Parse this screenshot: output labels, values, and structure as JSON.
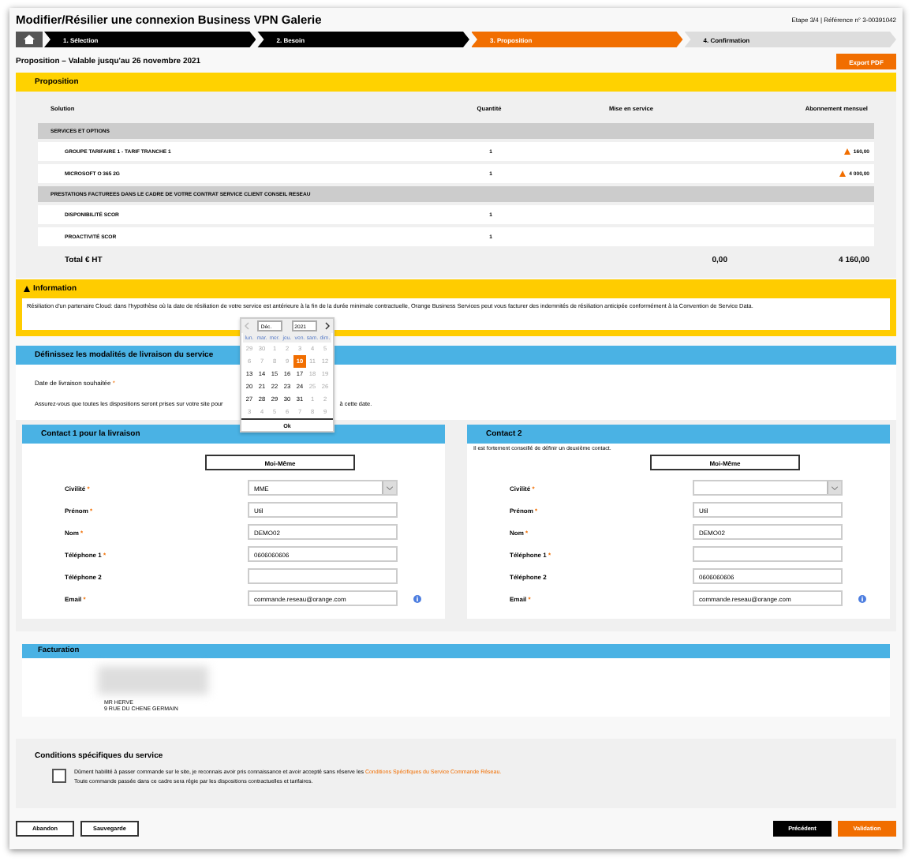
{
  "header": {
    "title": "Modifier/Résilier une connexion Business VPN Galerie",
    "step_info": "Etape 3/4 | Référence n° 3-00391042"
  },
  "stepper": [
    {
      "label": "1. Sélection",
      "completed": true,
      "selected": false
    },
    {
      "label": "2. Besoin",
      "completed": true,
      "selected": false
    },
    {
      "label": "3. Proposition",
      "completed": false,
      "selected": true
    },
    {
      "label": "4. Confirmation",
      "completed": false,
      "selected": false
    }
  ],
  "proposal": {
    "validity": "Proposition – Valable jusqu'au 26 novembre 2021",
    "export_button": "Export PDF",
    "section_title": "Proposition",
    "columns": [
      "Solution",
      "Quantité",
      "Mise en service",
      "Abonnement mensuel"
    ],
    "groups": [
      {
        "title": "SERVICES ET OPTIONS",
        "rows": [
          {
            "solution": "GROUPE TARIFAIRE 1 - TARIF TRANCHE 1",
            "quantity": "1",
            "monthly": "160,00",
            "warning": true
          },
          {
            "solution": "MICROSOFT O 365 2G",
            "quantity": "1",
            "monthly": "4 000,00",
            "warning": true
          }
        ]
      },
      {
        "title": "PRESTATIONS FACTUREES DANS LE CADRE DE VOTRE CONTRAT SERVICE CLIENT CONSEIL RESEAU",
        "rows": [
          {
            "solution": "DISPONIBILITÉ SCOR",
            "quantity": "1",
            "warning": false
          },
          {
            "solution": "PROACTIVITÉ SCOR",
            "quantity": "1",
            "warning": false
          }
        ]
      }
    ],
    "total": {
      "label": "Total € HT",
      "setup": "0,00",
      "monthly": "4 160,00"
    }
  },
  "info": {
    "title": "Information",
    "text": "Résiliation d'un partenaire Cloud: dans l'hypothèse où la date de résiliation de votre service est antérieure à la fin de la durée minimale contractuelle, Orange Business Services peut vous facturer des indemnités de résiliation anticipée conformément à la Convention de Service Data."
  },
  "delivery": {
    "title": "Définissez les modalités de livraison du service",
    "date_label": "Date de livraison souhaitée",
    "required_mark": "*",
    "note_start": "Assurez-vous que toutes les dispositions seront prises sur votre site pour",
    "note_end": "à cette date."
  },
  "datepicker": {
    "month": "Déc.",
    "year": "2021",
    "weekdays": [
      "lun.",
      "mar.",
      "mer.",
      "jeu.",
      "ven.",
      "sam.",
      "dim."
    ],
    "days": [
      {
        "label": "29",
        "disabled": true,
        "selected": false
      },
      {
        "label": "30",
        "disabled": true,
        "selected": false
      },
      {
        "label": "1",
        "disabled": true,
        "selected": false
      },
      {
        "label": "2",
        "disabled": true,
        "selected": false
      },
      {
        "label": "3",
        "disabled": true,
        "selected": false
      },
      {
        "label": "4",
        "disabled": true,
        "selected": false
      },
      {
        "label": "5",
        "disabled": true,
        "selected": false
      },
      {
        "label": "6",
        "disabled": true,
        "selected": false
      },
      {
        "label": "7",
        "disabled": true,
        "selected": false
      },
      {
        "label": "8",
        "disabled": true,
        "selected": false
      },
      {
        "label": "9",
        "disabled": true,
        "selected": false
      },
      {
        "label": "10",
        "disabled": false,
        "selected": true
      },
      {
        "label": "11",
        "disabled": true,
        "selected": false
      },
      {
        "label": "12",
        "disabled": true,
        "selected": false
      },
      {
        "label": "13",
        "disabled": false,
        "selected": false
      },
      {
        "label": "14",
        "disabled": false,
        "selected": false
      },
      {
        "label": "15",
        "disabled": false,
        "selected": false
      },
      {
        "label": "16",
        "disabled": false,
        "selected": false
      },
      {
        "label": "17",
        "disabled": false,
        "selected": false
      },
      {
        "label": "18",
        "disabled": true,
        "selected": false
      },
      {
        "label": "19",
        "disabled": true,
        "selected": false
      },
      {
        "label": "20",
        "disabled": false,
        "selected": false
      },
      {
        "label": "21",
        "disabled": false,
        "selected": false
      },
      {
        "label": "22",
        "disabled": false,
        "selected": false
      },
      {
        "label": "23",
        "disabled": false,
        "selected": false
      },
      {
        "label": "24",
        "disabled": false,
        "selected": false
      },
      {
        "label": "25",
        "disabled": true,
        "selected": false
      },
      {
        "label": "26",
        "disabled": true,
        "selected": false
      },
      {
        "label": "27",
        "disabled": false,
        "selected": false
      },
      {
        "label": "28",
        "disabled": false,
        "selected": false
      },
      {
        "label": "29",
        "disabled": false,
        "selected": false
      },
      {
        "label": "30",
        "disabled": false,
        "selected": false
      },
      {
        "label": "31",
        "disabled": false,
        "selected": false
      },
      {
        "label": "1",
        "disabled": true,
        "selected": false
      },
      {
        "label": "2",
        "disabled": true,
        "selected": false
      },
      {
        "label": "3",
        "disabled": true,
        "selected": false
      },
      {
        "label": "4",
        "disabled": true,
        "selected": false
      },
      {
        "label": "5",
        "disabled": true,
        "selected": false
      },
      {
        "label": "6",
        "disabled": true,
        "selected": false
      },
      {
        "label": "7",
        "disabled": true,
        "selected": false
      },
      {
        "label": "8",
        "disabled": true,
        "selected": false
      },
      {
        "label": "9",
        "disabled": true,
        "selected": false
      }
    ],
    "ok": "Ok"
  },
  "contacts": [
    {
      "title": "Contact 1 pour la livraison",
      "me_button": "Moi-Même",
      "fields": [
        {
          "label": "Civilité",
          "required_mark": "*",
          "kind": "select",
          "value": "MME",
          "info": false
        },
        {
          "label": "Prénom",
          "required_mark": "*",
          "kind": "text",
          "value": "Util",
          "info": false
        },
        {
          "label": "Nom",
          "required_mark": "*",
          "kind": "text",
          "value": "DEMO02",
          "info": false
        },
        {
          "label": "Téléphone 1",
          "required_mark": "*",
          "kind": "text",
          "value": "0606060606",
          "info": false
        },
        {
          "label": "Téléphone 2",
          "kind": "text",
          "info": false
        },
        {
          "label": "Email",
          "required_mark": "*",
          "kind": "text",
          "value": "commande.reseau@orange.com",
          "info": true
        }
      ]
    },
    {
      "title": "Contact 2",
      "hint": "Il est fortement conseillé de définir un deuxième contact.",
      "me_button": "Moi-Même",
      "fields": [
        {
          "label": "Civilité",
          "required_mark": "*",
          "kind": "select",
          "info": false
        },
        {
          "label": "Prénom",
          "required_mark": "*",
          "kind": "text",
          "value": "Util",
          "info": false
        },
        {
          "label": "Nom",
          "required_mark": "*",
          "kind": "text",
          "value": "DEMO02",
          "info": false
        },
        {
          "label": "Téléphone 1",
          "required_mark": "*",
          "kind": "text",
          "info": false
        },
        {
          "label": "Téléphone 2",
          "kind": "text",
          "value": "0606060606",
          "info": false
        },
        {
          "label": "Email",
          "required_mark": "*",
          "kind": "text",
          "value": "commande.reseau@orange.com",
          "info": true
        }
      ]
    }
  ],
  "billing": {
    "title": "Facturation",
    "lines": [
      "MR HERVE",
      "9 RUE DU CHENE GERMAIN"
    ]
  },
  "conditions": {
    "title": "Conditions spécifiques du service",
    "checked": false,
    "text": "Dûment habilité à passer commande sur le site, je reconnais avoir pris connaissance et avoir accepté sans réserve les",
    "link": "Conditions Spécifiques du Service Commande Réseau.",
    "text2": "Toute commande passée dans ce cadre sera régie par les dispositions contractuelles et tarifaires."
  },
  "footer_buttons": [
    {
      "label": "Abandon",
      "kind": "outline"
    },
    {
      "label": "Sauvegarde",
      "kind": "outline"
    },
    {
      "label": "Précédent",
      "kind": "dark"
    },
    {
      "label": "Validation",
      "kind": "primary"
    }
  ]
}
